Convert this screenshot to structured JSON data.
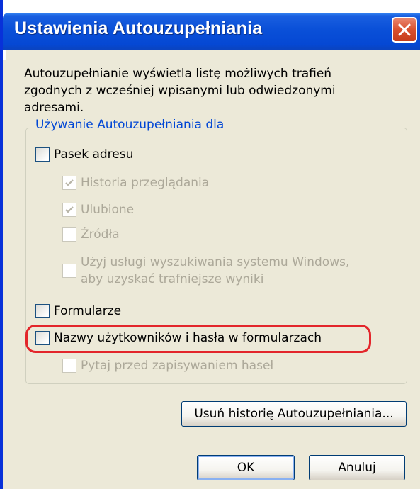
{
  "window": {
    "title": "Ustawienia Autouzupełniania",
    "close_icon": "close-icon"
  },
  "description": "Autouzupełnianie wyświetla listę możliwych trafień zgodnych z wcześniej wpisanymi lub odwiedzonymi adresami.",
  "group": {
    "legend": "Używanie Autouzupełniania dla",
    "options": [
      {
        "label": "Pasek adresu",
        "checked": false,
        "enabled": true
      },
      {
        "label": "Historia przeglądania",
        "checked": true,
        "enabled": false
      },
      {
        "label": "Ulubione",
        "checked": true,
        "enabled": false
      },
      {
        "label": "Źródła",
        "checked": false,
        "enabled": false
      },
      {
        "label_line1": "Użyj usługi wyszukiwania systemu Windows,",
        "label_line2": "aby uzyskać trafniejsze wyniki",
        "checked": false,
        "enabled": false
      },
      {
        "label": "Formularze",
        "checked": false,
        "enabled": true
      },
      {
        "label": "Nazwy użytkowników i hasła w formularzach",
        "checked": false,
        "enabled": true,
        "highlighted": true
      },
      {
        "label": "Pytaj przed zapisywaniem haseł",
        "checked": false,
        "enabled": false
      }
    ]
  },
  "buttons": {
    "delete_history": "Usuń historię Autouzupełniania...",
    "ok": "OK",
    "cancel": "Anuluj"
  },
  "colors": {
    "titlebar": "#0a50d8",
    "window_bg": "#ece9d8",
    "legend_text": "#0046d5",
    "disabled_text": "#aca899",
    "highlight": "#e3262b"
  }
}
